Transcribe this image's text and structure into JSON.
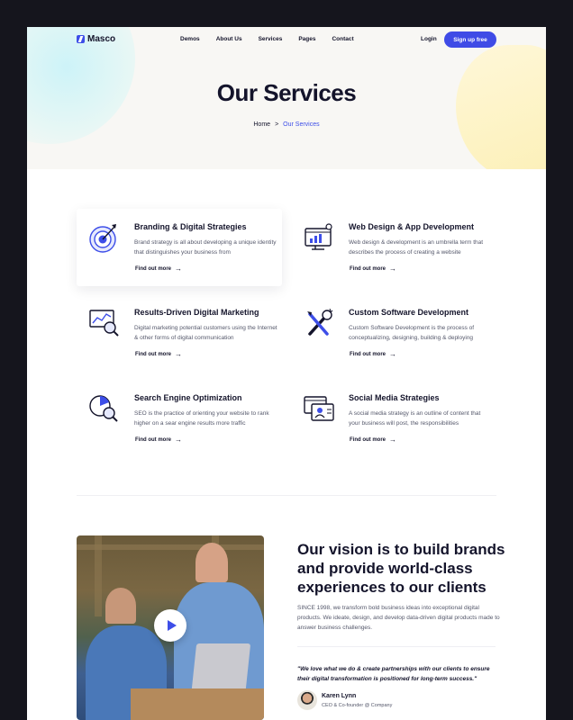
{
  "nav": {
    "brand": "Masco",
    "menu": [
      "Demos",
      "About Us",
      "Services",
      "Pages",
      "Contact"
    ],
    "login": "Login",
    "signup": "Sign up free"
  },
  "hero": {
    "title": "Our Services",
    "breadcrumb": {
      "home": "Home",
      "separator": ">",
      "current": "Our Services"
    }
  },
  "services": [
    {
      "title": "Branding & Digital Strategies",
      "desc": "Brand strategy is all about developing a unique identity that distinguishes your business from",
      "link": "Find out more",
      "icon": "target-icon"
    },
    {
      "title": "Web Design & App Development",
      "desc": "Web design & development is an umbrella term that describes the process of creating a website",
      "link": "Find out more",
      "icon": "monitor-chart-icon"
    },
    {
      "title": "Results-Driven Digital Marketing",
      "desc": "Digital marketing potential customers using the Internet & other forms of digital communication",
      "link": "Find out more",
      "icon": "analytics-magnifier-icon"
    },
    {
      "title": "Custom Software Development",
      "desc": "Custom Software Development is the process of conceptualizing, designing, building & deploying",
      "link": "Find out more",
      "icon": "tools-icon"
    },
    {
      "title": "Search Engine Optimization",
      "desc": "SEO is the practice of orienting your website to rank higher on a sear engine results more traffic",
      "link": "Find out more",
      "icon": "seo-magnifier-icon"
    },
    {
      "title": "Social Media Strategies",
      "desc": "A social media strategy is an outline of content that your business will post, the responsibilities",
      "link": "Find out more",
      "icon": "social-profile-icon"
    }
  ],
  "vision": {
    "title": "Our vision is to build brands and provide world-class experiences to our clients",
    "body": "SINCE 1998, we transform bold business ideas into exceptional digital products. We ideate, design, and develop data-driven digital products made to answer business challenges.",
    "quote": "\"We love what we do & create partnerships with our clients to ensure their digital transformation is positioned for long-term success.\"",
    "author": "Karen Lynn",
    "role": "CEO & Co-founder @ Company"
  },
  "colors": {
    "accent": "#3d4ee8",
    "text": "#14142b",
    "muted": "#55586b",
    "frame": "#15151d"
  }
}
